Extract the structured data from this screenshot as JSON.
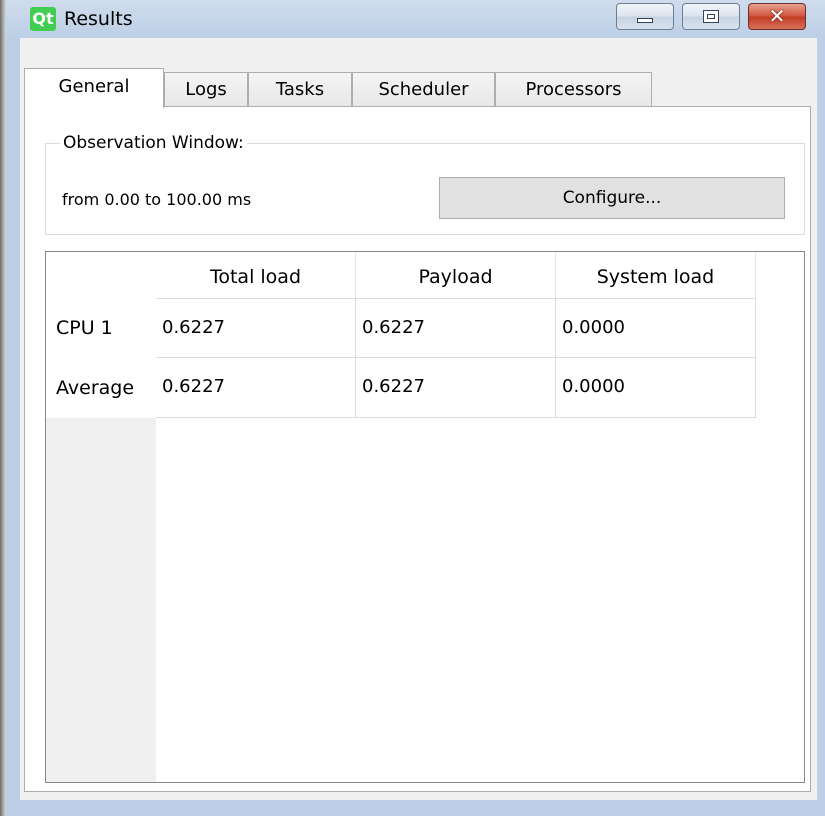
{
  "window": {
    "title": "Results",
    "logo_text": "Qt",
    "minimize_icon": "minimize-icon",
    "maximize_icon": "maximize-icon",
    "close_icon": "close-icon",
    "close_glyph": "✕"
  },
  "tabs": [
    {
      "label": "General",
      "active": true
    },
    {
      "label": "Logs",
      "active": false
    },
    {
      "label": "Tasks",
      "active": false
    },
    {
      "label": "Scheduler",
      "active": false
    },
    {
      "label": "Processors",
      "active": false
    }
  ],
  "observation": {
    "group_title": "Observation Window:",
    "range_text": "from 0.00 to 100.00 ms",
    "configure_label": "Configure..."
  },
  "table": {
    "columns": [
      "Total load",
      "Payload",
      "System load"
    ],
    "rows": [
      {
        "label": "CPU 1",
        "values": [
          "0.6227",
          "0.6227",
          "0.0000"
        ]
      },
      {
        "label": "Average",
        "values": [
          "0.6227",
          "0.6227",
          "0.0000"
        ]
      }
    ]
  }
}
